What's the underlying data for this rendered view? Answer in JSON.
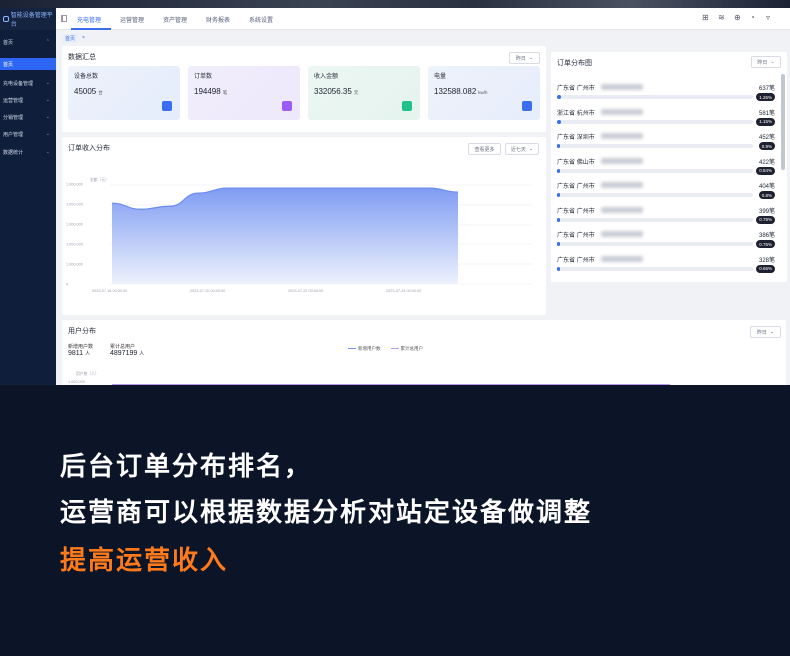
{
  "nav": {
    "logo_text": "智能设备管理平台",
    "items": [
      "充电管理",
      "运营管理",
      "资产管理",
      "财务报表",
      "系统设置"
    ],
    "icons": [
      "book-icon",
      "wifi-icon",
      "globe-icon",
      "bell-icon",
      "avatar"
    ],
    "icon_glyphs": [
      "⊞",
      "≋",
      "⊕",
      "◔",
      "▿"
    ]
  },
  "sidebar": {
    "items": [
      {
        "label": "首页",
        "expandable": true
      },
      {
        "label": "首页",
        "expandable": false
      },
      {
        "label": "充电设备管理",
        "expandable": true
      },
      {
        "label": "运营管理",
        "expandable": true
      },
      {
        "label": "分销管理",
        "expandable": true
      },
      {
        "label": "用户管理",
        "expandable": true
      },
      {
        "label": "数据统计",
        "expandable": true
      }
    ]
  },
  "breadcrumb": {
    "home": "首页",
    "close": "×"
  },
  "summary": {
    "title": "数据汇总",
    "filter": "昨日",
    "stats": [
      {
        "label": "设备总数",
        "value": "45005",
        "unit": "台",
        "icon": "device-icon",
        "color": "#3c6df0"
      },
      {
        "label": "订单数",
        "value": "194498",
        "unit": "笔",
        "icon": "document-icon",
        "color": "#9b5cf6"
      },
      {
        "label": "收入金额",
        "value": "332056.35",
        "unit": "元",
        "icon": "wallet-icon",
        "color": "#22c08a"
      },
      {
        "label": "电量",
        "value": "132588.082",
        "unit": "kw/h",
        "icon": "lightning-icon",
        "color": "#3c6df0"
      }
    ]
  },
  "revenue_chart": {
    "title": "订单收入分布",
    "view_more": "查看更多",
    "range": "近七天",
    "y_unit": "金额（元）",
    "chart_data": {
      "type": "area",
      "ylabel": "金额（元）",
      "ylim": [
        0,
        1000000
      ],
      "ytick_labels": [
        "0",
        "1,000,000",
        "1,000,000",
        "1,000,000",
        "1,000,000",
        "1,000,000"
      ],
      "xtick_labels": [
        "2023-07-18 00:00:00",
        "2023-07-20 00:00:00",
        "2023-07-22 00:00:00",
        "2023-07-24 00:00:00"
      ],
      "series": [
        {
          "values": [
            0.8,
            0.74,
            0.77,
            0.9,
            0.95,
            0.95,
            0.95,
            0.95,
            0.95,
            0.95,
            0.95,
            0.95,
            0.91
          ]
        }
      ]
    }
  },
  "ranking": {
    "title": "订单分布图",
    "filter": "昨日",
    "items": [
      {
        "province": "广东省",
        "city": "广州市",
        "count": "637笔",
        "pct": "1.26%",
        "ratio": 1.26
      },
      {
        "province": "浙江省",
        "city": "杭州市",
        "count": "581笔",
        "pct": "1.15%",
        "ratio": 1.15
      },
      {
        "province": "广东省",
        "city": "深圳市",
        "count": "452笔",
        "pct": "0.9%",
        "ratio": 0.9
      },
      {
        "province": "广东省",
        "city": "佛山市",
        "count": "422笔",
        "pct": "0.84%",
        "ratio": 0.84
      },
      {
        "province": "广东省",
        "city": "广州市",
        "count": "404笔",
        "pct": "0.8%",
        "ratio": 0.8
      },
      {
        "province": "广东省",
        "city": "广州市",
        "count": "399笔",
        "pct": "0.79%",
        "ratio": 0.79
      },
      {
        "province": "广东省",
        "city": "广州市",
        "count": "386笔",
        "pct": "0.76%",
        "ratio": 0.76
      },
      {
        "province": "广东省",
        "city": "广州市",
        "count": "328笔",
        "pct": "0.65%",
        "ratio": 0.65
      }
    ]
  },
  "users": {
    "title": "用户分布",
    "filter": "昨日",
    "new_label": "新增用户数",
    "new_value": "9811",
    "new_unit": "人",
    "total_label": "累计总用户",
    "total_value": "4897199",
    "total_unit": "人",
    "legend": [
      "新增用户数",
      "累计总用户"
    ],
    "y_unit": "用户数（人）",
    "y_top": "1,000,000"
  },
  "promo": {
    "line1": "后台订单分布排名，",
    "line2": "运营商可以根据数据分析对站定设备做调整",
    "line3": "提高运营收入"
  }
}
